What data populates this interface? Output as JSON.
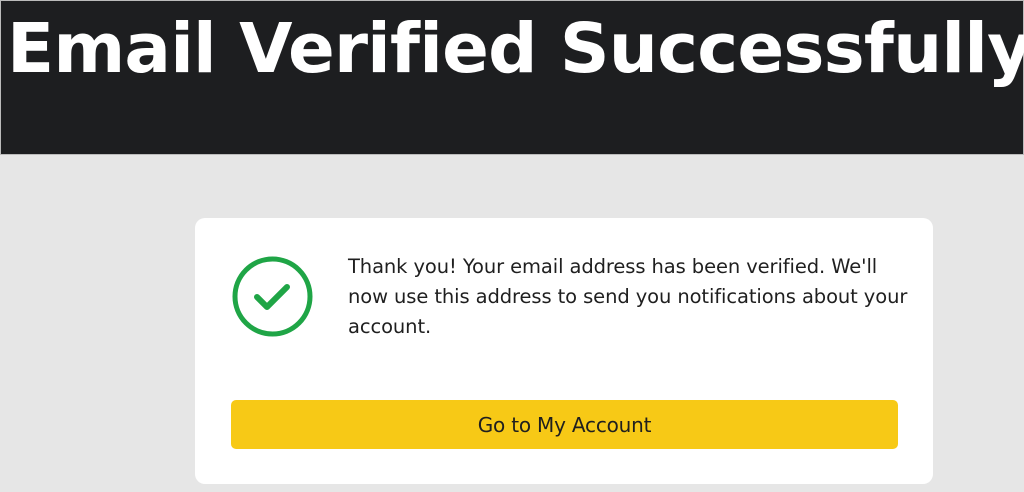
{
  "header": {
    "title": "Email Verified Successfully",
    "background_color": "#1d1e20",
    "text_color": "#ffffff"
  },
  "card": {
    "status_icon": "check-circle-icon",
    "status_icon_color": "#1fa546",
    "message": "Thank you! Your email address has been verified. We'll now use this address to send you notifications about your account.",
    "button_label": "Go to My Account",
    "button_color": "#f7c916"
  },
  "page": {
    "background_color": "#e6e6e6"
  }
}
